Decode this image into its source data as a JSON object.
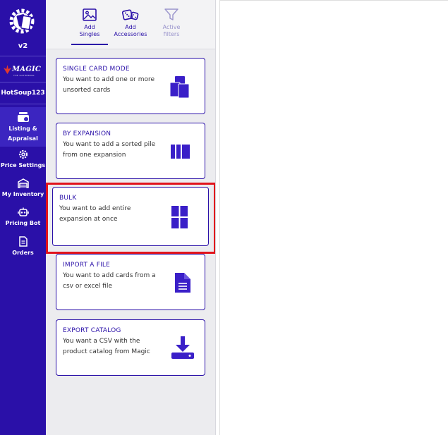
{
  "sidebar": {
    "version": "v2",
    "brand": "MAGIC",
    "brand_sub": "THE GATHERING",
    "user": "HotSoup123",
    "items": [
      {
        "label": "Listing & Appraisal",
        "icon": "cards-stack-icon",
        "active": true
      },
      {
        "label": "Price Settings",
        "icon": "gear-icon",
        "active": false
      },
      {
        "label": "My Inventory",
        "icon": "warehouse-icon",
        "active": false
      },
      {
        "label": "Pricing Bot",
        "icon": "robot-icon",
        "active": false
      },
      {
        "label": "Orders",
        "icon": "document-icon",
        "active": false
      }
    ],
    "bg_color": "#2a10a8"
  },
  "toolbar": {
    "add_singles": "Add Singles",
    "add_accessories": "Add Accessories",
    "active_filters": "Active filters"
  },
  "modes": [
    {
      "title": "SINGLE CARD MODE",
      "desc": "You want to add one or more unsorted cards",
      "icon": "stacked-cards-icon"
    },
    {
      "title": "BY EXPANSION",
      "desc": "You want to add a sorted pile from one expansion",
      "icon": "columns-icon"
    },
    {
      "title": "BULK",
      "desc": "You want to add entire expansion at once",
      "icon": "grid-icon"
    },
    {
      "title": "IMPORT A FILE",
      "desc": "You want to add cards from a csv or excel file",
      "icon": "file-icon"
    },
    {
      "title": "EXPORT CATALOG",
      "desc": "You want a CSV with the product catalog from Magic",
      "icon": "download-icon"
    }
  ],
  "colors": {
    "accent": "#2a10a8",
    "highlight": "#e1141c"
  }
}
